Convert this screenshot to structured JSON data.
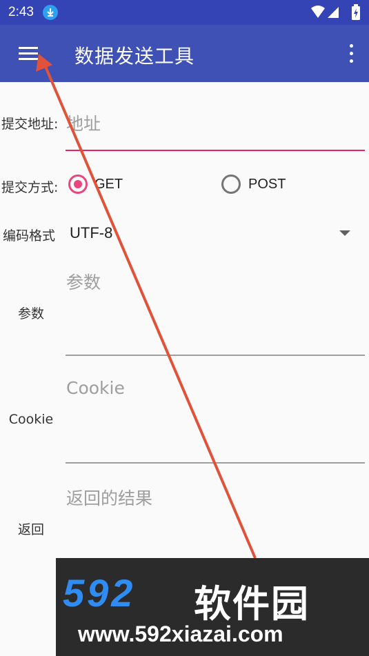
{
  "status_bar": {
    "time": "2:43",
    "download_icon": "download-icon",
    "wifi_icon": "wifi-icon",
    "signal_icon": "signal-icon",
    "battery_icon": "battery-icon"
  },
  "app_bar": {
    "title": "数据发送工具",
    "menu_icon": "hamburger-menu-icon",
    "more_icon": "more-vert-icon",
    "color": "#3f51b5"
  },
  "form": {
    "url_label": "提交地址:",
    "url_hint": "地址",
    "method_label": "提交方式:",
    "method_options": [
      "GET",
      "POST"
    ],
    "method_selected": "GET",
    "encoding_label": "编码格式",
    "encoding_value": "UTF-8",
    "params_label": "参数",
    "params_hint": "参数",
    "cookie_label": "Cookie",
    "cookie_hint": "Cookie",
    "result_label": "返回",
    "result_hint": "返回的结果"
  },
  "colors": {
    "accent": "#e91e63",
    "annotation_arrow": "#e0523a"
  },
  "watermark": {
    "brand": "592",
    "brand_cn": "软件园",
    "url": "www.592xiazai.com"
  }
}
